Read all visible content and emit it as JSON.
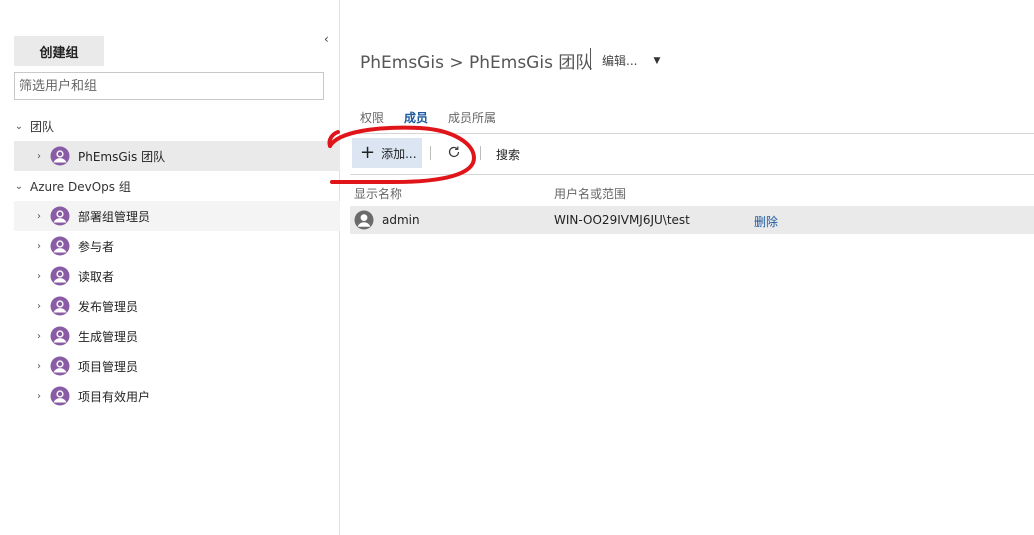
{
  "sidebar": {
    "create_group_label": "创建组",
    "collapse_glyph": "‹",
    "filter_placeholder": "筛选用户和组",
    "sections": [
      {
        "label": "团队",
        "items": [
          {
            "label": "PhEmsGis 团队"
          }
        ]
      },
      {
        "label": "Azure DevOps 组",
        "items": [
          {
            "label": "部署组管理员"
          },
          {
            "label": "参与者"
          },
          {
            "label": "读取者"
          },
          {
            "label": "发布管理员"
          },
          {
            "label": "生成管理员"
          },
          {
            "label": "项目管理员"
          },
          {
            "label": "项目有效用户"
          }
        ]
      }
    ]
  },
  "header": {
    "breadcrumb": "PhEmsGis > PhEmsGis 团队",
    "edit_label": "编辑..."
  },
  "tabs": [
    {
      "label": "权限",
      "active": false
    },
    {
      "label": "成员",
      "active": true
    },
    {
      "label": "成员所属",
      "active": false
    }
  ],
  "toolbar": {
    "add_label": "添加...",
    "search_label": "搜索"
  },
  "members_table": {
    "columns": [
      "显示名称",
      "用户名或范围"
    ],
    "rows": [
      {
        "display_name": "admin",
        "scope": "WIN-OO29IVMJ6JU\\test",
        "action": "删除"
      }
    ]
  },
  "colors": {
    "accent": "#1e5aa0",
    "group_icon": "#8a5ca6",
    "annotation": "#e0151a"
  },
  "icons": {
    "tree_expand": "chevron-right-icon",
    "section_expand": "chevron-down-icon",
    "group": "group-icon",
    "user": "user-avatar-icon",
    "add": "plus-icon",
    "refresh": "refresh-icon",
    "edit_dropdown": "caret-down-icon"
  }
}
